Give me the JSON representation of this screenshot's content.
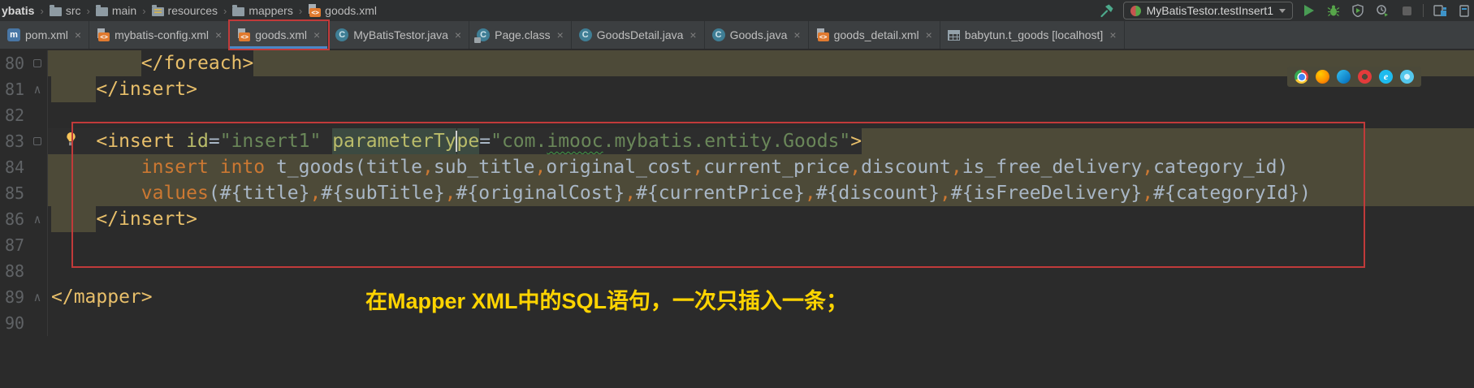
{
  "breadcrumb": {
    "items": [
      {
        "label": "ybatis",
        "icon": null,
        "bold": true
      },
      {
        "label": "src",
        "icon": "folder"
      },
      {
        "label": "main",
        "icon": "folder"
      },
      {
        "label": "resources",
        "icon": "resources"
      },
      {
        "label": "mappers",
        "icon": "folder"
      },
      {
        "label": "goods.xml",
        "icon": "xml"
      }
    ]
  },
  "toolbar": {
    "run_config": "MyBatisTestor.testInsert1",
    "buttons": [
      "build-hammer",
      "run",
      "debug",
      "run-with-coverage",
      "profiler",
      "stop",
      "project-windows"
    ]
  },
  "tabs": [
    {
      "label": "pom.xml",
      "icon": "maven"
    },
    {
      "label": "mybatis-config.xml",
      "icon": "xml"
    },
    {
      "label": "goods.xml",
      "icon": "xml",
      "selected": true,
      "annotated": true
    },
    {
      "label": "MyBatisTestor.java",
      "icon": "class"
    },
    {
      "label": "Page.class",
      "icon": "class-locked"
    },
    {
      "label": "GoodsDetail.java",
      "icon": "class"
    },
    {
      "label": "Goods.java",
      "icon": "class"
    },
    {
      "label": "goods_detail.xml",
      "icon": "xml"
    },
    {
      "label": "babytun.t_goods [localhost]",
      "icon": "table"
    }
  ],
  "editor": {
    "annotation": "在Mapper XML中的SQL语句，一次只插入一条；",
    "browser_icons": [
      "chrome",
      "firefox",
      "edge",
      "opera",
      "ie",
      "edge-beta"
    ],
    "lines": [
      {
        "num": 80,
        "indent": 8,
        "fold": "box",
        "inj": "full",
        "segments": [
          {
            "c": "tag host",
            "t": "</foreach>"
          }
        ]
      },
      {
        "num": 81,
        "indent": 4,
        "fold": "end",
        "inj": "lead",
        "segments": [
          {
            "c": "tag",
            "t": "</insert>"
          }
        ]
      },
      {
        "num": 82,
        "indent": 0,
        "segments": []
      },
      {
        "num": 83,
        "indent": 4,
        "fold": "box",
        "inj": "trail",
        "cur": true,
        "segments": [
          {
            "c": "tag",
            "t": "<insert"
          },
          {
            "c": "pl",
            "t": " "
          },
          {
            "c": "attr",
            "t": "id"
          },
          {
            "c": "pl",
            "t": "="
          },
          {
            "c": "str",
            "t": "\"insert1\""
          },
          {
            "c": "pl",
            "t": " "
          },
          {
            "c": "attr hl",
            "t": "parameterTy"
          },
          {
            "c": "caret",
            "t": ""
          },
          {
            "c": "attr hl",
            "t": "pe"
          },
          {
            "c": "pl",
            "t": "="
          },
          {
            "c": "str",
            "t": "\"com."
          },
          {
            "c": "str wavy",
            "t": "imooc"
          },
          {
            "c": "str",
            "t": ".mybatis.entity.Goods\""
          },
          {
            "c": "tag",
            "t": ">"
          }
        ]
      },
      {
        "num": 84,
        "indent": 8,
        "inj": "full",
        "segments": [
          {
            "c": "kw",
            "t": "insert"
          },
          {
            "c": "pl",
            "t": " "
          },
          {
            "c": "kw",
            "t": "into"
          },
          {
            "c": "pl",
            "t": " t_goods(title"
          },
          {
            "c": "kw",
            "t": ","
          },
          {
            "c": "pl",
            "t": "sub_title"
          },
          {
            "c": "kw",
            "t": ","
          },
          {
            "c": "pl",
            "t": "original_cost"
          },
          {
            "c": "kw",
            "t": ","
          },
          {
            "c": "pl",
            "t": "current_price"
          },
          {
            "c": "kw",
            "t": ","
          },
          {
            "c": "pl",
            "t": "discount"
          },
          {
            "c": "kw",
            "t": ","
          },
          {
            "c": "pl",
            "t": "is_free_delivery"
          },
          {
            "c": "kw",
            "t": ","
          },
          {
            "c": "pl",
            "t": "category_id)"
          }
        ]
      },
      {
        "num": 85,
        "indent": 8,
        "inj": "full",
        "segments": [
          {
            "c": "kw",
            "t": "values"
          },
          {
            "c": "pl",
            "t": "(#{title}"
          },
          {
            "c": "kw",
            "t": ","
          },
          {
            "c": "pl",
            "t": "#{subTitle}"
          },
          {
            "c": "kw",
            "t": ","
          },
          {
            "c": "pl",
            "t": "#{originalCost}"
          },
          {
            "c": "kw",
            "t": ","
          },
          {
            "c": "pl",
            "t": "#{currentPrice}"
          },
          {
            "c": "kw",
            "t": ","
          },
          {
            "c": "pl",
            "t": "#{discount}"
          },
          {
            "c": "kw",
            "t": ","
          },
          {
            "c": "pl",
            "t": "#{isFreeDelivery}"
          },
          {
            "c": "kw",
            "t": ","
          },
          {
            "c": "pl",
            "t": "#{categoryId})"
          }
        ]
      },
      {
        "num": 86,
        "indent": 4,
        "fold": "end",
        "inj": "lead",
        "segments": [
          {
            "c": "tag",
            "t": "</insert>"
          }
        ]
      },
      {
        "num": 87,
        "indent": 0,
        "segments": []
      },
      {
        "num": 88,
        "indent": 0,
        "segments": []
      },
      {
        "num": 89,
        "indent": 0,
        "fold": "end",
        "segments": [
          {
            "c": "tag",
            "t": "</mapper>"
          }
        ]
      },
      {
        "num": 90,
        "indent": 0,
        "segments": []
      }
    ]
  },
  "colors": {
    "injection_bg": "#4D4A38",
    "annotation_red": "#C13A3A",
    "annotation_yellow": "#FFD400",
    "tab_underline": "#4A88C7",
    "editor_bg": "#2B2B2B"
  }
}
